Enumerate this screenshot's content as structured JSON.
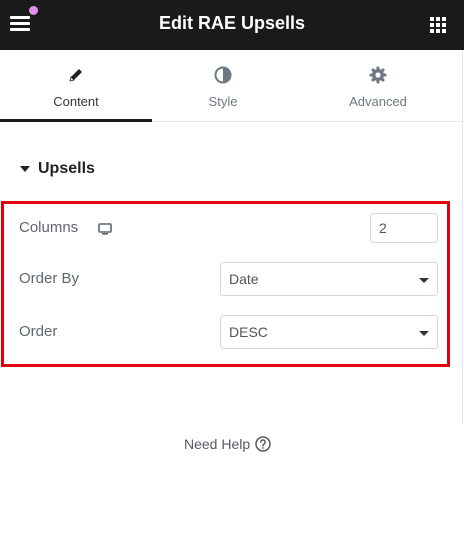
{
  "header": {
    "title": "Edit RAE Upsells",
    "menu_icon": "hamburger-menu-icon",
    "apps_icon": "grid-apps-icon",
    "notification_dot_color": "#e88df0"
  },
  "tabs": [
    {
      "label": "Content",
      "icon": "pencil-icon",
      "active": true
    },
    {
      "label": "Style",
      "icon": "half-circle-icon",
      "active": false
    },
    {
      "label": "Advanced",
      "icon": "gear-icon",
      "active": false
    }
  ],
  "section": {
    "title": "Upsells",
    "expanded": true
  },
  "controls": {
    "columns": {
      "label": "Columns",
      "value": "2",
      "device_icon": "desktop-icon"
    },
    "order_by": {
      "label": "Order By",
      "value": "Date"
    },
    "order": {
      "label": "Order",
      "value": "DESC"
    }
  },
  "help": {
    "label": "Need Help"
  },
  "colors": {
    "header_bg": "#1a1a1a",
    "highlight_border": "#e3000f",
    "active_tab_underline": "#1a1a1a"
  }
}
